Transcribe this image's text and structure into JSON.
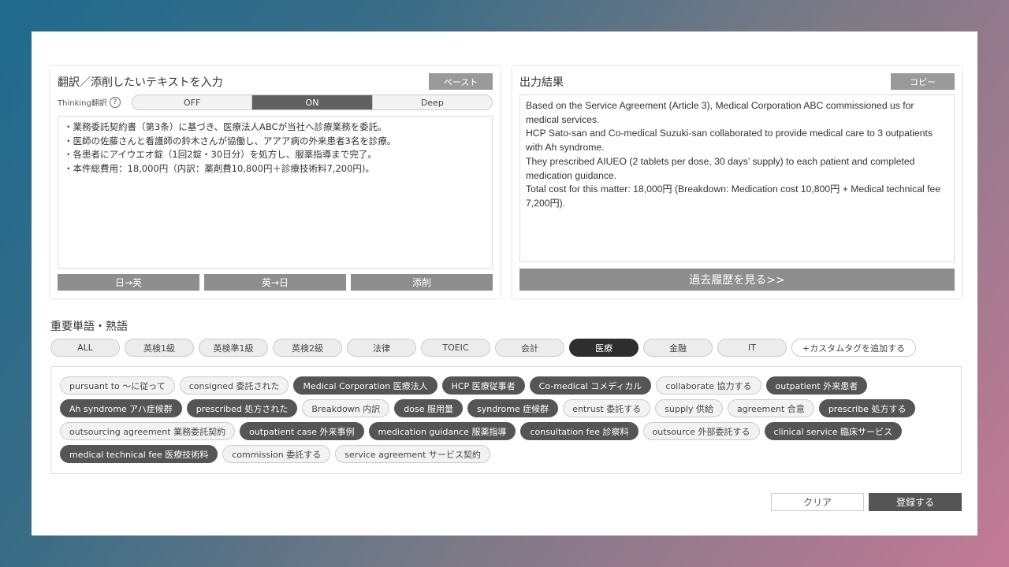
{
  "input_panel": {
    "title": "翻訳／添削したいテキストを入力",
    "paste_label": "ペースト",
    "thinking_label": "Thinking翻訳",
    "help_glyph": "?",
    "modes": [
      {
        "label": "OFF",
        "active": false
      },
      {
        "label": "ON",
        "active": true
      },
      {
        "label": "Deep",
        "active": false
      }
    ],
    "lines": [
      "・業務委託契約書（第3条）に基づき、医療法人ABCが当社へ診療業務を委託。",
      "・医師の佐藤さんと看護師の鈴木さんが協働し、アアア病の外来患者3名を診療。",
      "・各患者にアイウエオ錠（1回2錠・30日分）を処方し、服薬指導まで完了。",
      "・本件総費用：18,000円（内訳：薬剤費10,800円＋診療技術料7,200円)。"
    ],
    "buttons": [
      "日→英",
      "英→日",
      "添削"
    ]
  },
  "output_panel": {
    "title": "出力結果",
    "copy_label": "コピー",
    "lines": [
      "Based on the Service Agreement (Article 3), Medical Corporation ABC commissioned us for medical services.",
      "HCP Sato-san and Co-medical Suzuki-san collaborated to provide medical care to 3 outpatients with Ah syndrome.",
      "They prescribed AIUEO (2 tablets per dose, 30 days’ supply) to each patient and completed medication guidance.",
      "Total cost for this matter: 18,000円 (Breakdown: Medication cost 10,800円 + Medical technical fee 7,200円)."
    ],
    "history_label": "過去履歴を見る>>"
  },
  "vocab": {
    "title": "重要単語・熟語",
    "tabs": [
      {
        "label": "ALL",
        "active": false
      },
      {
        "label": "英検1級",
        "active": false
      },
      {
        "label": "英検準1級",
        "active": false
      },
      {
        "label": "英検2級",
        "active": false
      },
      {
        "label": "法律",
        "active": false
      },
      {
        "label": "TOEIC",
        "active": false
      },
      {
        "label": "会計",
        "active": false
      },
      {
        "label": "医療",
        "active": true
      },
      {
        "label": "金融",
        "active": false
      },
      {
        "label": "IT",
        "active": false
      }
    ],
    "add_tag_label": "+カスタムタグを追加する",
    "tags": [
      {
        "label": "pursuant to ～に従って",
        "selected": false
      },
      {
        "label": "consigned 委託された",
        "selected": false
      },
      {
        "label": "Medical Corporation 医療法人",
        "selected": true
      },
      {
        "label": "HCP 医療従事者",
        "selected": true
      },
      {
        "label": "Co-medical コメディカル",
        "selected": true
      },
      {
        "label": "collaborate 協力する",
        "selected": false
      },
      {
        "label": "outpatient 外来患者",
        "selected": true
      },
      {
        "label": "Ah syndrome アハ症候群",
        "selected": true
      },
      {
        "label": "prescribed 処方された",
        "selected": true
      },
      {
        "label": "Breakdown 内訳",
        "selected": false
      },
      {
        "label": "dose 服用量",
        "selected": true
      },
      {
        "label": "syndrome 症候群",
        "selected": true
      },
      {
        "label": "entrust 委託する",
        "selected": false
      },
      {
        "label": "supply 供給",
        "selected": false
      },
      {
        "label": "agreement 合意",
        "selected": false
      },
      {
        "label": "prescribe 処方する",
        "selected": true
      },
      {
        "label": "outsourcing agreement 業務委託契約",
        "selected": false
      },
      {
        "label": "outpatient case 外来事例",
        "selected": true
      },
      {
        "label": "medication guidance 服薬指導",
        "selected": true
      },
      {
        "label": "consultation fee 診察料",
        "selected": true
      },
      {
        "label": "outsource 外部委託する",
        "selected": false
      },
      {
        "label": "clinical service 臨床サービス",
        "selected": true
      },
      {
        "label": "medical technical fee 医療技術料",
        "selected": true
      },
      {
        "label": "commission 委託する",
        "selected": false
      },
      {
        "label": "service agreement サービス契約",
        "selected": false
      }
    ]
  },
  "footer": {
    "clear_label": "クリア",
    "register_label": "登録する"
  }
}
